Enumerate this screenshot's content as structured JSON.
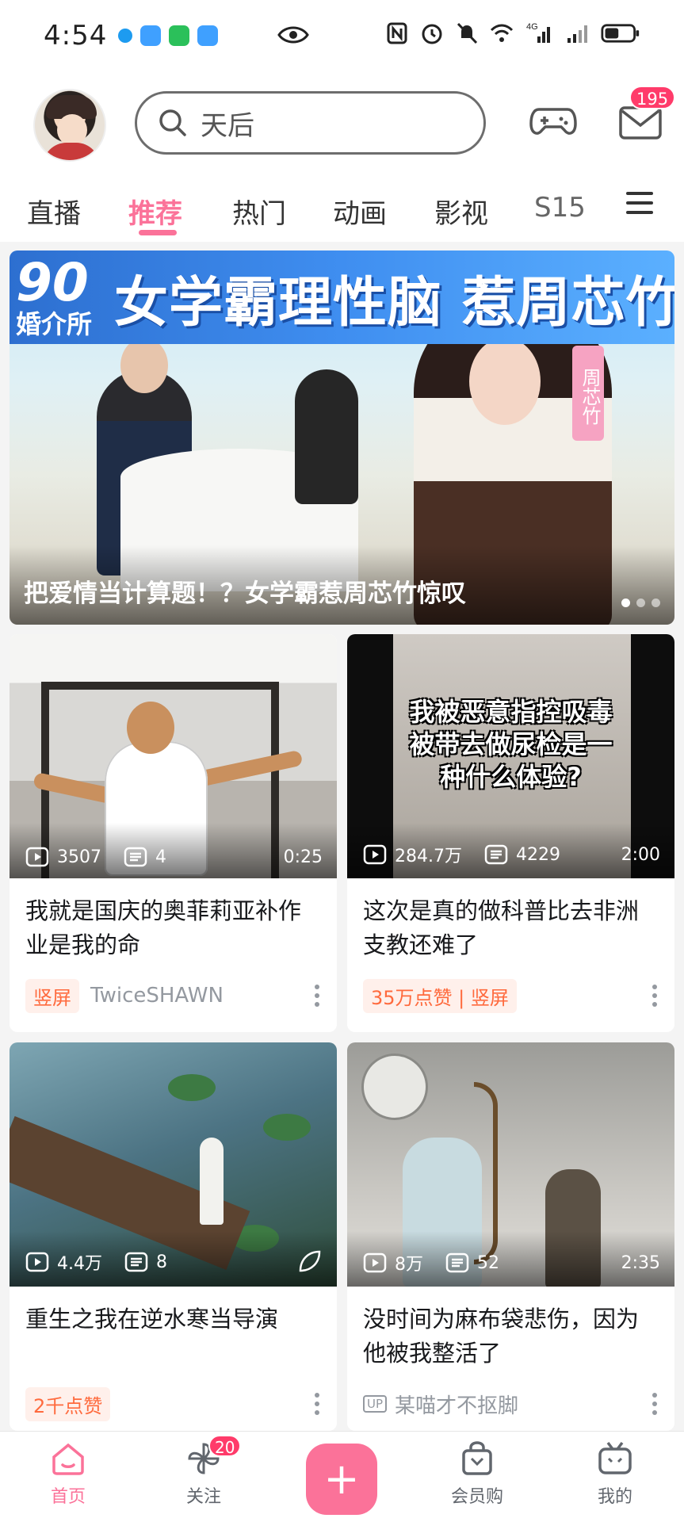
{
  "status_bar": {
    "time": "4:54",
    "network": "4G",
    "app_dot_colors": [
      "#1d9bf0",
      "#3fa0ff",
      "#2bc05a",
      "#3fa0ff"
    ]
  },
  "header": {
    "search_placeholder": "天后",
    "mail_badge": "195",
    "tabs": [
      "直播",
      "推荐",
      "热门",
      "动画",
      "影视",
      "S15"
    ],
    "active_tab": "推荐"
  },
  "banner": {
    "headline": "女学霸理性脑 惹周芯竹惊叹",
    "logo_num": "90",
    "logo_sub": "婚介所",
    "side_tag": "周芯竹",
    "caption": "把爱情当计算题！？女学霸惹周芯竹惊叹",
    "slide_count": 3,
    "active_slide": 1
  },
  "feed": [
    {
      "views": "3507",
      "danmaku": "4",
      "duration": "0:25",
      "title": "我就是国庆的奥菲莉亚补作业是我的命",
      "tag": "竖屏",
      "author": "TwiceSHAWN",
      "overlay_text": ""
    },
    {
      "views": "284.7万",
      "danmaku": "4229",
      "duration": "2:00",
      "title": "这次是真的做科普比去非洲支教还难了",
      "tag": "35万点赞 | 竖屏",
      "author": "",
      "overlay_text": "我被恶意指控吸毒被带去做尿检是一种什么体验?"
    },
    {
      "views": "4.4万",
      "danmaku": "8",
      "duration": "",
      "title": "重生之我在逆水寒当导演",
      "tag": "2千点赞",
      "author": "",
      "overlay_text": ""
    },
    {
      "views": "8万",
      "danmaku": "52",
      "duration": "2:35",
      "title": "没时间为麻布袋悲伤，因为他被我整活了",
      "tag": "",
      "author": "某喵才不抠脚",
      "up_label": "UP",
      "overlay_text": ""
    }
  ],
  "bottom_nav": {
    "items": [
      {
        "label": "首页",
        "icon": "home-icon",
        "active": true
      },
      {
        "label": "关注",
        "icon": "pinwheel-icon",
        "badge": "20"
      },
      {
        "label": "",
        "icon": "plus-icon"
      },
      {
        "label": "会员购",
        "icon": "shopping-bag-icon"
      },
      {
        "label": "我的",
        "icon": "tv-icon"
      }
    ],
    "publish_symbol": "+"
  },
  "colors": {
    "accent": "#fb7299",
    "badge": "#ff3b6a",
    "tag_text": "#ff6a3d",
    "muted": "#9499a0"
  }
}
